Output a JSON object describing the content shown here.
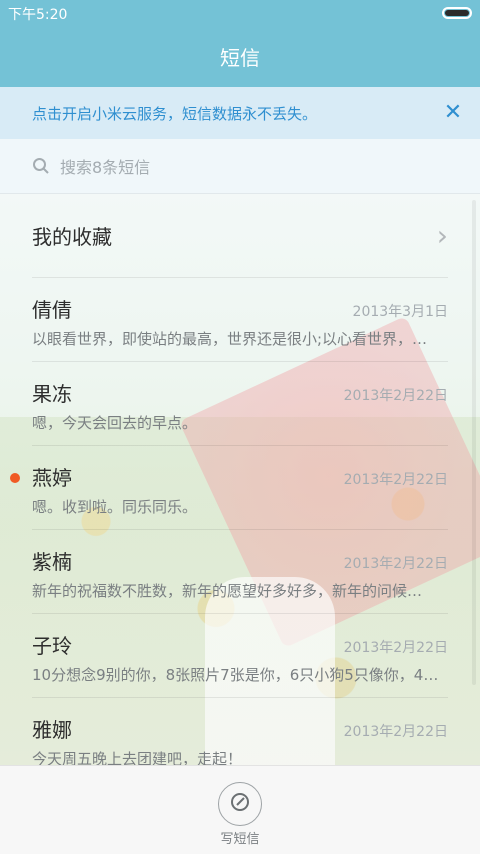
{
  "status_bar": {
    "time": "下午5:20"
  },
  "title": "短信",
  "banner": {
    "text": "点击开启小米云服务，短信数据永不丢失。"
  },
  "search": {
    "placeholder": "搜索8条短信"
  },
  "favorites": {
    "label": "我的收藏"
  },
  "conversations": [
    {
      "name": "倩倩",
      "date": "2013年3月1日",
      "preview": "以眼看世界，即使站的最高，世界还是很小;以心看世界，…"
    },
    {
      "name": "果冻",
      "date": "2013年2月22日",
      "preview": "嗯，今天会回去的早点。"
    },
    {
      "name": "燕婷",
      "date": "2013年2月22日",
      "preview": "嗯。收到啦。同乐同乐。",
      "unread": true
    },
    {
      "name": "紫楠",
      "date": "2013年2月22日",
      "preview": "新年的祝福数不胜数，新年的愿望好多好多，新年的问候…"
    },
    {
      "name": "子玲",
      "date": "2013年2月22日",
      "preview": "10分想念9别的你，8张照片7张是你，6只小狗5只像你，4…"
    },
    {
      "name": "雅娜",
      "date": "2013年2月22日",
      "preview": "今天周五晚上去团建吧，走起！"
    }
  ],
  "compose": {
    "label": "写短信"
  },
  "colors": {
    "accent": "#74c2d6",
    "banner_text": "#2f8fd0",
    "unread": "#f05a24"
  }
}
